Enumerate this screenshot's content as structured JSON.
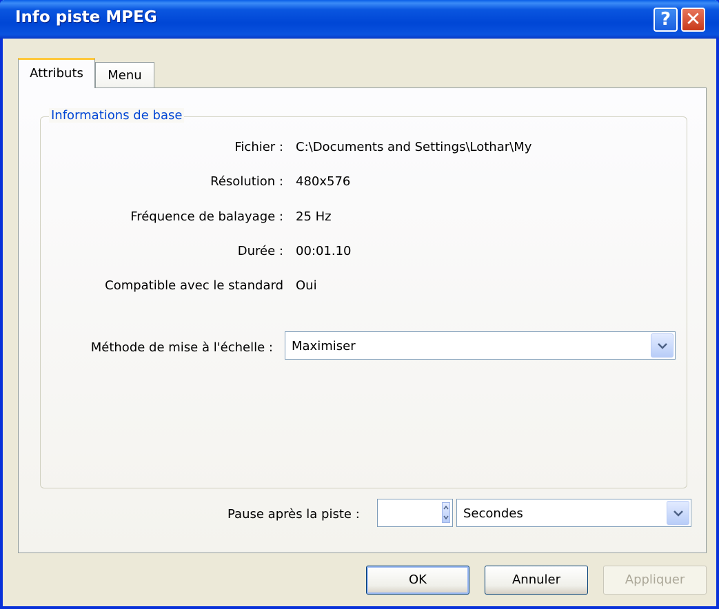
{
  "window": {
    "title": "Info piste MPEG",
    "help_label": "?",
    "close_label": "✕"
  },
  "tabs": [
    {
      "label": "Attributs",
      "active": true
    },
    {
      "label": "Menu",
      "active": false
    }
  ],
  "groupbox": {
    "title": "Informations de base",
    "rows": [
      {
        "label": "Fichier :",
        "value": "C:\\Documents and Settings\\Lothar\\My"
      },
      {
        "label": "Résolution :",
        "value": "480x576"
      },
      {
        "label": "Fréquence de balayage :",
        "value": "25 Hz"
      },
      {
        "label": "Durée :",
        "value": "00:01.10"
      },
      {
        "label": "Compatible avec le standard",
        "value": "Oui"
      }
    ],
    "scaling": {
      "label": "Méthode de mise à l'échelle :",
      "selected": "Maximiser"
    }
  },
  "pause": {
    "label": "Pause après la piste :",
    "value": "",
    "unit": "Secondes"
  },
  "buttons": {
    "ok": "OK",
    "cancel": "Annuler",
    "apply": "Appliquer"
  },
  "colors": {
    "titlebar": "#0a56e0",
    "group_label": "#0046d5",
    "tab_accent": "#ffc83c"
  }
}
